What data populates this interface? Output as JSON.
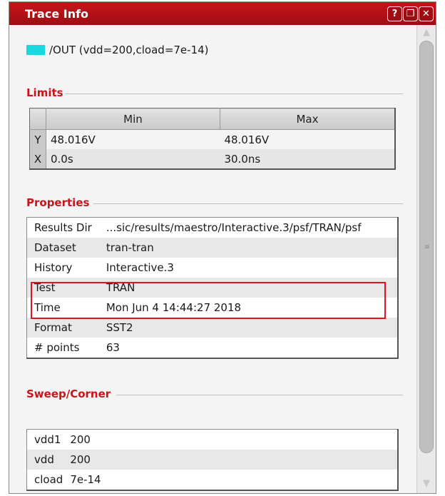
{
  "window": {
    "title": "Trace Info"
  },
  "titlebar_buttons": [
    {
      "name": "help",
      "glyph": "?"
    },
    {
      "name": "restore",
      "glyph": "❐"
    },
    {
      "name": "close",
      "glyph": "✕"
    }
  ],
  "trace": {
    "label": "/OUT (vdd=200,cload=7e-14)",
    "color": "#19d7df"
  },
  "limits": {
    "heading": "Limits",
    "columns": [
      "Min",
      "Max"
    ],
    "rows": [
      {
        "axis": "Y",
        "min": "48.016V",
        "max": "48.016V"
      },
      {
        "axis": "X",
        "min": "0.0s",
        "max": "30.0ns"
      }
    ]
  },
  "properties": {
    "heading": "Properties",
    "rows": [
      {
        "key": "Results Dir",
        "value": "...sic/results/maestro/Interactive.3/psf/TRAN/psf"
      },
      {
        "key": "Dataset",
        "value": "tran-tran"
      },
      {
        "key": "History",
        "value": "Interactive.3"
      },
      {
        "key": "Test",
        "value": "TRAN"
      },
      {
        "key": "Time",
        "value": "Mon Jun 4 14:44:27 2018"
      },
      {
        "key": "Format",
        "value": "SST2"
      },
      {
        "key": "# points",
        "value": "63"
      }
    ]
  },
  "sweep": {
    "heading": "Sweep/Corner",
    "rows": [
      {
        "key": "vdd1",
        "value": "200"
      },
      {
        "key": "vdd",
        "value": "200"
      },
      {
        "key": "cload",
        "value": "7e-14"
      }
    ]
  },
  "colors": {
    "accent": "#c8141a",
    "highlight": "#e0141a"
  }
}
